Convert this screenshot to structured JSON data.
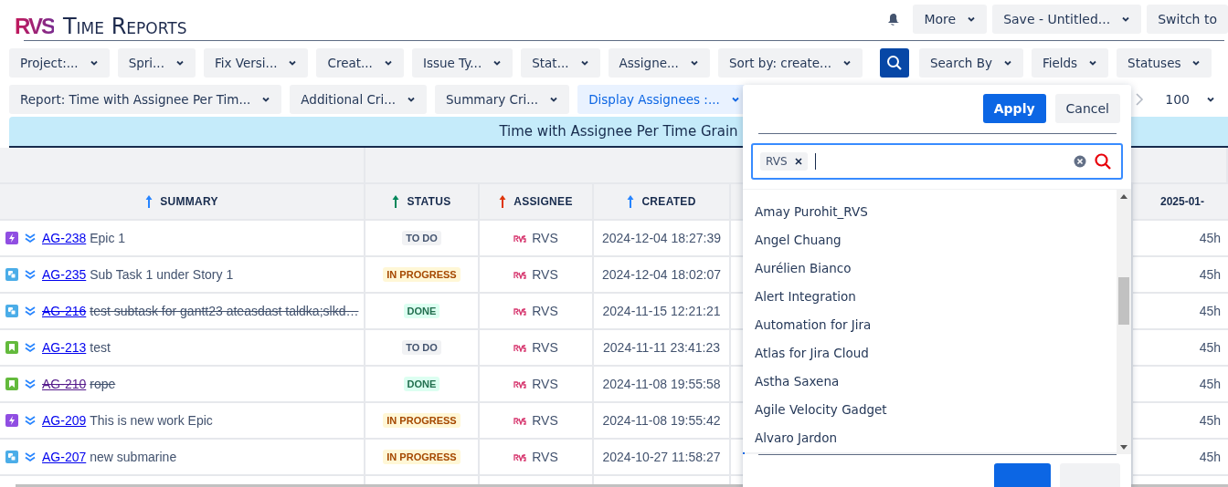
{
  "header": {
    "logo": "RVS",
    "title": "Time Reports",
    "actions": [
      {
        "label": "More",
        "kind": "dropdown"
      },
      {
        "label": "Save - Untitled...",
        "kind": "dropdown"
      },
      {
        "label": "Switch to",
        "kind": "button"
      }
    ]
  },
  "filters_row1": [
    {
      "label": "Project:...",
      "kind": "dropdown"
    },
    {
      "label": "Spri...",
      "kind": "dropdown"
    },
    {
      "label": "Fix Versi...",
      "kind": "dropdown"
    },
    {
      "label": "Creat...",
      "kind": "dropdown"
    },
    {
      "label": "Issue Ty...",
      "kind": "dropdown"
    },
    {
      "label": "Stat...",
      "kind": "dropdown"
    },
    {
      "label": "Assigne...",
      "kind": "dropdown"
    },
    {
      "label": "Sort by: create...",
      "kind": "dropdown"
    },
    {
      "kind": "search"
    },
    {
      "label": "Search By",
      "kind": "dropdown"
    },
    {
      "label": "Fields",
      "kind": "dropdown"
    },
    {
      "label": "Statuses",
      "kind": "dropdown"
    }
  ],
  "filters_row2": [
    {
      "label": "Report: Time with Assignee Per Tim...",
      "selected": false
    },
    {
      "label": "Additional Cri...",
      "selected": false
    },
    {
      "label": "Summary Cri...",
      "selected": false
    },
    {
      "label": "Display Assignees :...",
      "selected": true
    }
  ],
  "page_size": "100",
  "banner": "Time with Assignee Per Time Grain",
  "table": {
    "columns": [
      {
        "label": "SUMMARY",
        "color": "#2684ff"
      },
      {
        "label": "STATUS",
        "color": "#00875a"
      },
      {
        "label": "ASSIGNEE",
        "color": "#de350b"
      },
      {
        "label": "CREATED",
        "color": "#2684ff"
      }
    ],
    "date_column": "2025-01-",
    "rows": [
      {
        "kind": "epic",
        "key": "AG-238",
        "summary": "Epic 1",
        "done": false,
        "visited": false,
        "status": {
          "label": "TO DO",
          "kind": "todo"
        },
        "assignee": "RVS",
        "created": "2024-12-04 18:27:39",
        "time": "45h"
      },
      {
        "kind": "subtask",
        "key": "AG-235",
        "summary": "Sub Task 1 under Story 1",
        "done": false,
        "visited": false,
        "status": {
          "label": "IN PROGRESS",
          "kind": "progress"
        },
        "assignee": "RVS",
        "created": "2024-12-04 18:02:07",
        "time": "45h"
      },
      {
        "kind": "subtask",
        "key": "AG-216",
        "summary": "test subtask for gantt23 ateasdast taldka;slkd…",
        "done": true,
        "visited": false,
        "status": {
          "label": "DONE",
          "kind": "done"
        },
        "assignee": "RVS",
        "created": "2024-11-15 12:21:21",
        "time": "45h"
      },
      {
        "kind": "story",
        "key": "AG-213",
        "summary": "test",
        "done": false,
        "visited": false,
        "status": {
          "label": "TO DO",
          "kind": "todo"
        },
        "assignee": "RVS",
        "created": "2024-11-11 23:41:23",
        "time": "45h"
      },
      {
        "kind": "story",
        "key": "AG-210",
        "summary": "rope",
        "done": true,
        "visited": true,
        "status": {
          "label": "DONE",
          "kind": "done"
        },
        "assignee": "RVS",
        "created": "2024-11-08 19:55:58",
        "time": "45h"
      },
      {
        "kind": "epic",
        "key": "AG-209",
        "summary": "This is new work Epic",
        "done": false,
        "visited": false,
        "status": {
          "label": "IN PROGRESS",
          "kind": "progress"
        },
        "assignee": "RVS",
        "created": "2024-11-08 19:55:42",
        "time": "45h"
      },
      {
        "kind": "subtask",
        "key": "AG-207",
        "summary": "new submarine",
        "done": false,
        "visited": false,
        "status": {
          "label": "IN PROGRESS",
          "kind": "progress"
        },
        "assignee": "RVS",
        "created": "2024-10-27 11:58:27",
        "time": "45h"
      }
    ]
  },
  "assignee_popup": {
    "apply": "Apply",
    "cancel": "Cancel",
    "chips": [
      "RVS"
    ],
    "options": [
      "Amay Purohit_RVS",
      "Angel Chuang",
      "Aurélien Bianco",
      "Alert Integration",
      "Automation for Jira",
      "Atlas for Jira Cloud",
      "Astha Saxena",
      "Agile Velocity Gadget",
      "Alvaro Jardon"
    ]
  }
}
